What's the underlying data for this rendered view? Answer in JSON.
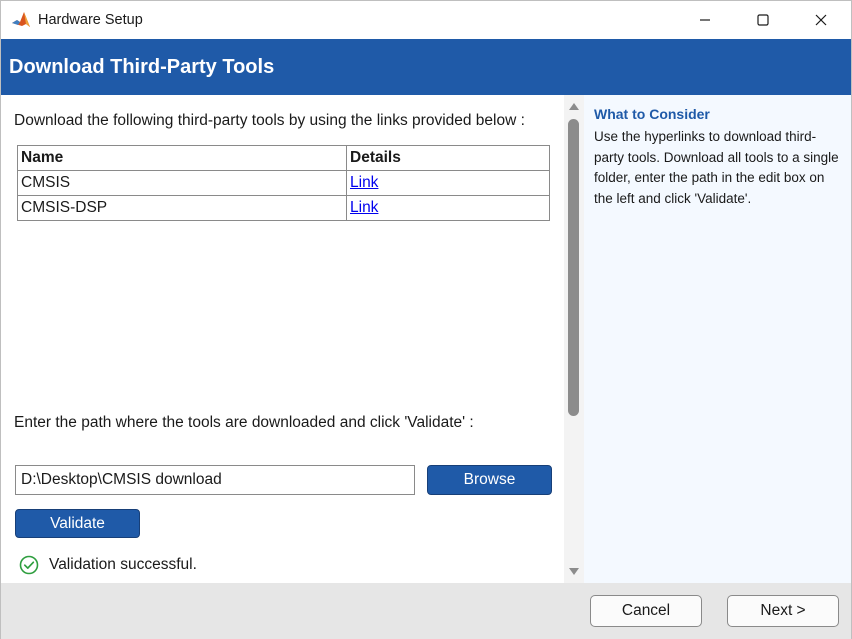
{
  "window": {
    "title": "Hardware Setup",
    "app_icon": "matlab-logo-icon",
    "controls": [
      "minimize-icon",
      "maximize-icon",
      "close-icon"
    ]
  },
  "header": {
    "title": "Download Third-Party Tools",
    "background": "#1f5aa8"
  },
  "main": {
    "instruction": "Download the following third-party tools by using the links provided below :",
    "table": {
      "headers": [
        "Name",
        "Details"
      ],
      "rows": [
        {
          "name": "CMSIS",
          "details": "Link"
        },
        {
          "name": "CMSIS-DSP",
          "details": "Link"
        }
      ]
    },
    "path_label": "Enter the path where the tools are downloaded and click 'Validate' :",
    "path_input": {
      "value": "D:\\Desktop\\CMSIS download"
    },
    "browse_label": "Browse",
    "validate_label": "Validate",
    "status": {
      "text": "Validation successful.",
      "icon": "check-circle-icon",
      "color": "#2e9e3f"
    }
  },
  "side_panel": {
    "heading": "What to Consider",
    "text": "Use the hyperlinks to download third-party tools. Download all tools to a single folder, enter the path in the edit box on the left and click 'Validate'."
  },
  "footer": {
    "cancel_label": "Cancel",
    "next_label": "Next >"
  }
}
